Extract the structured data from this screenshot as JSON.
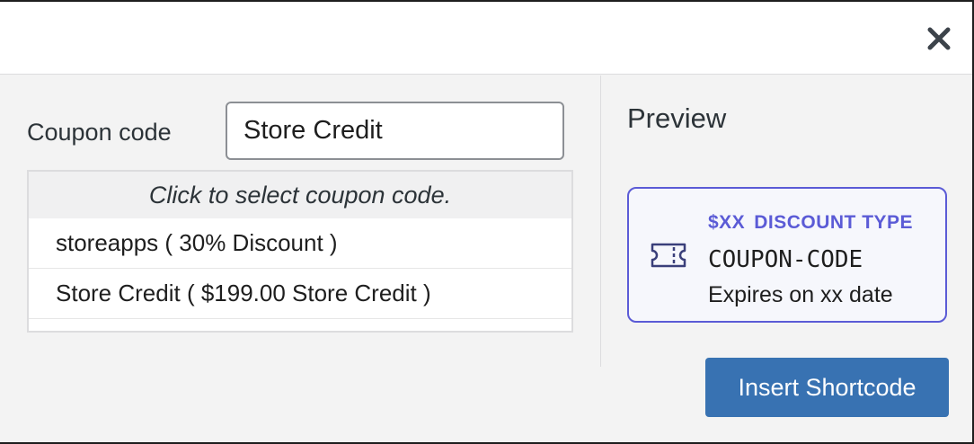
{
  "header": {
    "close_icon": "close-icon"
  },
  "coupon": {
    "label": "Coupon code",
    "input_value": "Store Credit",
    "placeholder": ""
  },
  "suggestions": {
    "hint": "Click to select coupon code.",
    "items": [
      {
        "label": "storeapps ( 30% Discount )"
      },
      {
        "label": "Store Credit ( $199.00 Store Credit )"
      }
    ]
  },
  "preview": {
    "title": "Preview",
    "card": {
      "amount": "$XX",
      "discount_type": "DISCOUNT TYPE",
      "code": "COUPON-CODE",
      "expiry": "Expires on xx date",
      "icon": "ticket-icon"
    }
  },
  "actions": {
    "insert_label": "Insert Shortcode"
  },
  "colors": {
    "accent": "#5b5bd6",
    "button": "#3872b2",
    "background": "#f3f3f3"
  }
}
